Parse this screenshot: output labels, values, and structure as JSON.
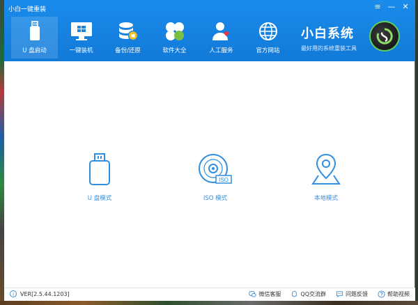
{
  "window": {
    "title": "小白一键重装",
    "controls": {
      "menu": "≡",
      "minimize": "—",
      "close": "✕"
    }
  },
  "nav": {
    "tabs": [
      {
        "label": "U 盘启动",
        "icon": "usb-drive-icon",
        "active": true
      },
      {
        "label": "一键装机",
        "icon": "monitor-windows-icon",
        "active": false
      },
      {
        "label": "备份/还原",
        "icon": "database-backup-icon",
        "active": false
      },
      {
        "label": "软件大全",
        "icon": "apps-grid-icon",
        "active": false
      },
      {
        "label": "人工服务",
        "icon": "person-heart-icon",
        "active": false
      },
      {
        "label": "官方网站",
        "icon": "globe-icon",
        "active": false
      }
    ]
  },
  "brand": {
    "name": "小白系统",
    "slogan": "最好用的系统重装工具"
  },
  "modes": [
    {
      "label": "U 盘模式",
      "icon": "usb-drive-icon"
    },
    {
      "label": "ISO 模式",
      "icon": "disc-iso-icon",
      "badge": "ISO"
    },
    {
      "label": "本地模式",
      "icon": "location-pin-icon"
    }
  ],
  "footer": {
    "version": "VER[2.5.44.1203]",
    "links": [
      {
        "label": "微信客服",
        "icon": "wechat-icon"
      },
      {
        "label": "QQ交流群",
        "icon": "qq-icon"
      },
      {
        "label": "问题反馈",
        "icon": "chat-bubble-icon"
      },
      {
        "label": "帮助视频",
        "icon": "help-icon"
      }
    ]
  },
  "colors": {
    "header": "#1279d7",
    "accent": "#2f8fe2"
  }
}
